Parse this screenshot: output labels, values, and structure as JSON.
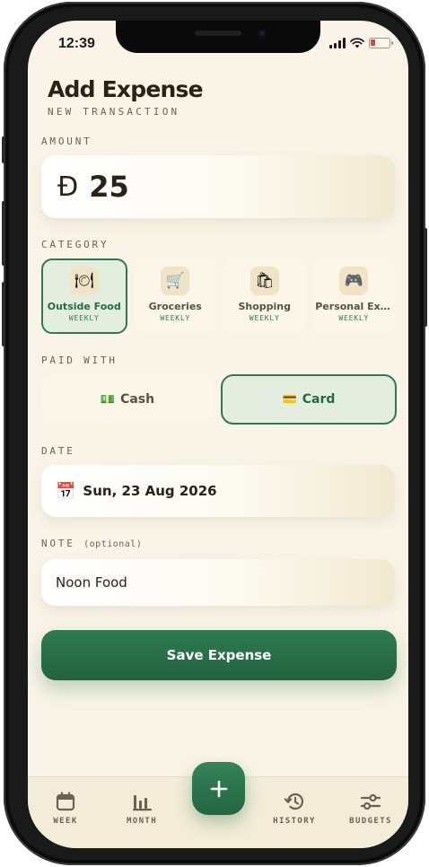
{
  "status": {
    "time": "12:39"
  },
  "header": {
    "title": "Add Expense",
    "subtitle": "NEW TRANSACTION"
  },
  "amount": {
    "label": "AMOUNT",
    "currency_symbol": "Đ",
    "value": "25"
  },
  "category": {
    "label": "CATEGORY",
    "items": [
      {
        "name": "Outside Food",
        "frequency": "WEEKLY",
        "icon": "🍽",
        "selected": true
      },
      {
        "name": "Groceries",
        "frequency": "WEEKLY",
        "icon": "🛒",
        "selected": false
      },
      {
        "name": "Shopping",
        "frequency": "WEEKLY",
        "icon": "🛍",
        "selected": false
      },
      {
        "name": "Personal Exp...",
        "frequency": "WEEKLY",
        "icon": "🎮",
        "selected": false
      }
    ]
  },
  "paid_with": {
    "label": "PAID WITH",
    "options": [
      {
        "label": "Cash",
        "icon": "💵",
        "selected": false
      },
      {
        "label": "Card",
        "icon": "💳",
        "selected": true
      }
    ]
  },
  "date": {
    "label": "DATE",
    "value": "Sun, 23 Aug 2026",
    "icon": "📅"
  },
  "note": {
    "label": "NOTE",
    "optional": "(optional)",
    "value": "Noon Food"
  },
  "save_button": {
    "label": "Save Expense"
  },
  "colors": {
    "accent": "#2e7a4e",
    "background": "#f9f4e7"
  },
  "nav": {
    "items": [
      {
        "label": "WEEK",
        "icon": "calendar-icon"
      },
      {
        "label": "MONTH",
        "icon": "bar-chart-icon"
      },
      {
        "label": "HISTORY",
        "icon": "history-icon"
      },
      {
        "label": "BUDGETS",
        "icon": "sliders-icon"
      }
    ],
    "fab_icon": "plus-icon"
  }
}
